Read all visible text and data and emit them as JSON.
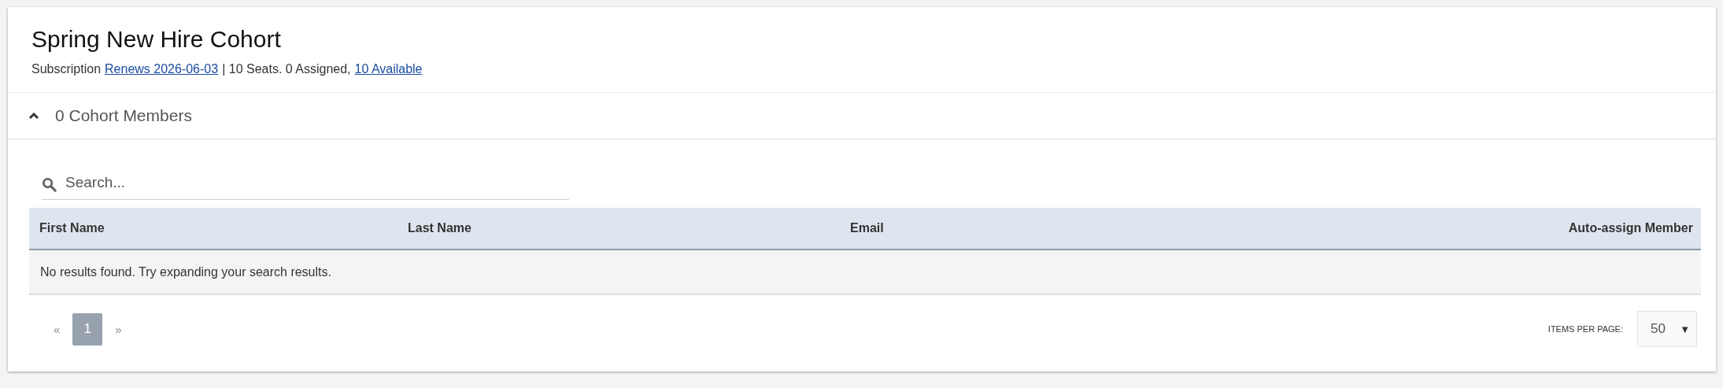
{
  "title": "Spring New Hire Cohort",
  "subscription": {
    "label": "Subscription",
    "renewal_link": "Renews 2026-06-03",
    "seats_text": "| 10 Seats. 0 Assigned,",
    "available_link": "10 Available"
  },
  "section": {
    "title": "0 Cohort Members",
    "expanded": true
  },
  "search": {
    "placeholder": "Search..."
  },
  "table": {
    "columns": [
      {
        "label": "First Name"
      },
      {
        "label": "Last Name"
      },
      {
        "label": "Email"
      },
      {
        "label": "Auto-assign Member"
      }
    ],
    "empty_message": "No results found. Try expanding your search results."
  },
  "pagination": {
    "prev": "«",
    "next": "»",
    "pages": [
      {
        "label": "1",
        "selected": true
      }
    ]
  },
  "items_per_page": {
    "label": "ITEMS PER PAGE:",
    "value": "50",
    "caret": "▼"
  }
}
